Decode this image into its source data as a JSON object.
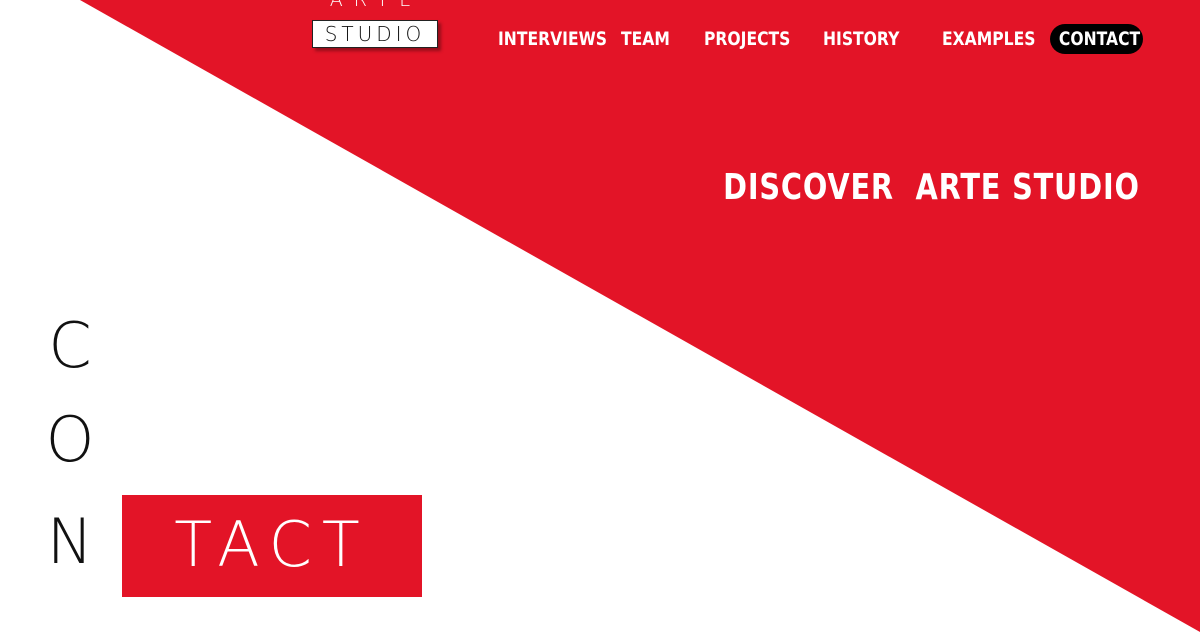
{
  "colors": {
    "accent_red": "#e31427",
    "background": "#ffffff",
    "contact_pill": "#000000"
  },
  "logo": {
    "top_text": "ARTE",
    "box_text": "STUDIO"
  },
  "nav": {
    "items": [
      {
        "label": "INTERVIEWS"
      },
      {
        "label": "TEAM"
      },
      {
        "label": "PROJECTS"
      },
      {
        "label": "HISTORY"
      },
      {
        "label": "EXAMPLES"
      }
    ],
    "contact_label": "CONTACT"
  },
  "hero": {
    "tagline": "DISCOVER  ARTE STUDIO"
  },
  "contact_title": {
    "letters": [
      "C",
      "O",
      "N"
    ],
    "highlight": "TACT"
  }
}
